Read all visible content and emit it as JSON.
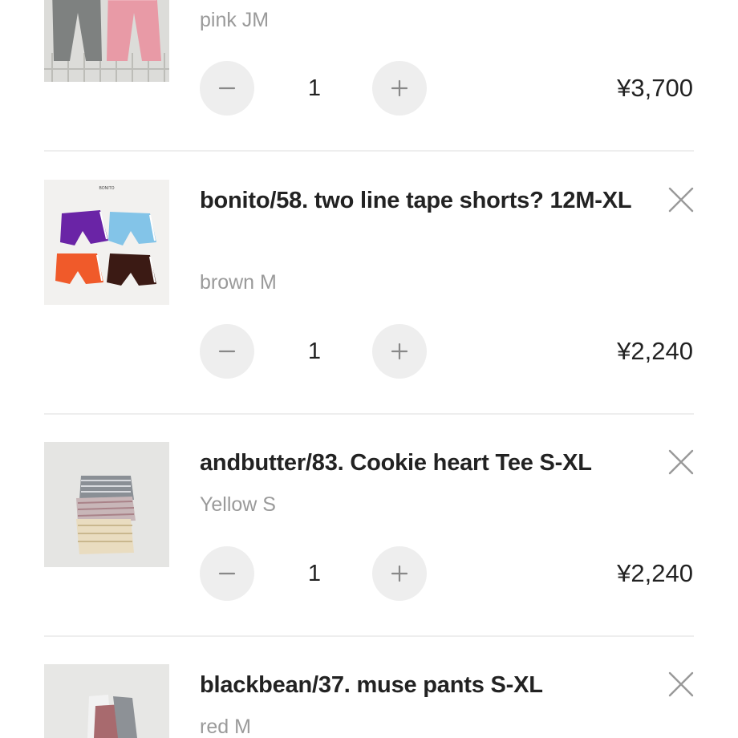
{
  "cart": {
    "items": [
      {
        "name": "",
        "variant": "pink JM",
        "quantity": "1",
        "price": "¥3,700",
        "minus_icon": "minus-icon",
        "plus_icon": "plus-icon"
      },
      {
        "name": "bonito/58. two line tape shorts? 12M-XL",
        "variant": "brown M",
        "quantity": "1",
        "price": "¥2,240",
        "thumb_brand": "BONITO",
        "remove_icon": "close-icon",
        "minus_icon": "minus-icon",
        "plus_icon": "plus-icon"
      },
      {
        "name": "andbutter/83. Cookie heart Tee S-XL",
        "variant": "Yellow S",
        "quantity": "1",
        "price": "¥2,240",
        "remove_icon": "close-icon",
        "minus_icon": "minus-icon",
        "plus_icon": "plus-icon"
      },
      {
        "name": "blackbean/37. muse pants S-XL",
        "variant": "red M",
        "remove_icon": "close-icon"
      }
    ]
  },
  "colors": {
    "text": "#222222",
    "muted": "#9a9a9a",
    "button_bg": "#eeeeee",
    "divider": "#eeeeee"
  }
}
